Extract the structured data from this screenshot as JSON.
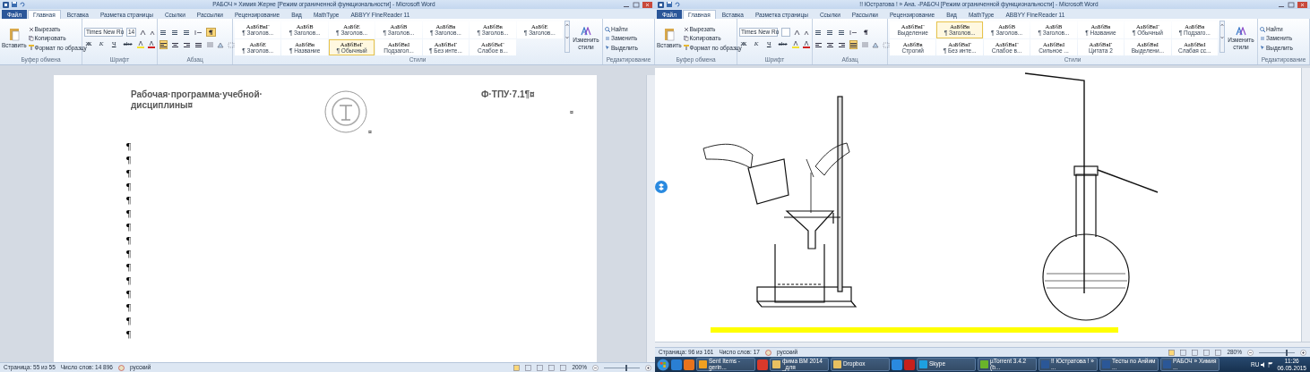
{
  "windows": [
    {
      "title": "РАБОЧ » Химия Жерне [Режим ограниченной функциональности] - Microsoft Word",
      "tabs": [
        {
          "label": "Файл",
          "selected": false
        },
        {
          "label": "Главная",
          "selected": true
        },
        {
          "label": "Вставка",
          "selected": false
        },
        {
          "label": "Разметка страницы",
          "selected": false
        },
        {
          "label": "Ссылки",
          "selected": false
        },
        {
          "label": "Рассылки",
          "selected": false
        },
        {
          "label": "Рецензирование",
          "selected": false
        },
        {
          "label": "Вид",
          "selected": false
        },
        {
          "label": "MathType",
          "selected": false
        },
        {
          "label": "ABBYY FineReader 11",
          "selected": false
        }
      ],
      "clipboard": {
        "paste": "Вставить",
        "commands": [
          "Вырезать",
          "Копировать",
          "Формат по образцу"
        ]
      },
      "font": {
        "name": "Times New Ro",
        "size": "14",
        "buttons": [
          "Ж",
          "К",
          "Ч",
          "abc"
        ]
      },
      "paragraph": {
        "show_marks": true,
        "align_buttons": [
          {
            "selected": true
          },
          {
            "selected": false
          },
          {
            "selected": false
          },
          {
            "selected": false
          }
        ]
      },
      "styles": [
        {
          "sample": "АаБбВвГ",
          "name": "¶ Заголов...",
          "selected": false
        },
        {
          "sample": "АаБбВ",
          "name": "¶ Заголов...",
          "selected": false
        },
        {
          "sample": "АаБбЕ",
          "name": "¶ Заголов...",
          "selected": false
        },
        {
          "sample": "АаБбВ",
          "name": "¶ Заголов...",
          "selected": false
        },
        {
          "sample": "АаБбВв",
          "name": "¶ Заголов...",
          "selected": false
        },
        {
          "sample": "АаБбВв",
          "name": "¶ Заголов...",
          "selected": false
        },
        {
          "sample": "АаБбЕ",
          "name": "¶ Заголов...",
          "selected": false
        },
        {
          "sample": "АаБбЕ",
          "name": "¶ Заголов...",
          "selected": false
        },
        {
          "sample": "АаБбВв",
          "name": "¶ Название",
          "selected": false
        },
        {
          "sample": "АаБбВеГ",
          "name": "¶ Обычный",
          "selected": true
        },
        {
          "sample": "АаБбВвI",
          "name": "Подзагол...",
          "selected": false
        },
        {
          "sample": "АаБбВеГ",
          "name": "¶ Без инте...",
          "selected": false
        },
        {
          "sample": "АаБбВеГ",
          "name": "Слабое в...",
          "selected": false
        }
      ],
      "change_styles": "Изменить стили",
      "editing": [
        "Найти",
        "Заменить",
        "Выделить"
      ],
      "group_labels": [
        "Буфер обмена",
        "Шрифт",
        "Абзац",
        "Стили",
        "Редактирование"
      ],
      "document": {
        "kind": "text_page",
        "header": [
          "Рабочая·программа·учебной· дисциплины¤",
          "¤",
          "Ф·ТПУ·7.1¶¤"
        ],
        "row_end_mark": "¤",
        "paragraphs": [
          "¶",
          "¶",
          "¶",
          "¶",
          "¶",
          "¶",
          "¶",
          "¶",
          "¶",
          "¶",
          "¶",
          "¶",
          "¶",
          "¶",
          "¶"
        ]
      },
      "status_bar": {
        "page": "Страница: 55 из 55",
        "words": "Число слов: 14 896",
        "language": "русский",
        "zoom": {
          "reading": "200%",
          "level": 0.6
        }
      }
    },
    {
      "title": "!! Юстратова ! » Ана. -РАБОЧ [Режим ограниченной функциональности] - Microsoft Word",
      "tabs": [
        {
          "label": "Файл",
          "selected": false
        },
        {
          "label": "Главная",
          "selected": true
        },
        {
          "label": "Вставка",
          "selected": false
        },
        {
          "label": "Разметка страницы",
          "selected": false
        },
        {
          "label": "Ссылки",
          "selected": false
        },
        {
          "label": "Рассылки",
          "selected": false
        },
        {
          "label": "Рецензирование",
          "selected": false
        },
        {
          "label": "Вид",
          "selected": false
        },
        {
          "label": "MathType",
          "selected": false
        },
        {
          "label": "ABBYY FineReader 11",
          "selected": false
        }
      ],
      "clipboard": {
        "paste": "Вставить",
        "commands": [
          "Вырезать",
          "Копировать",
          "Формат по образцу"
        ]
      },
      "font": {
        "name": "Times New Ro",
        "buttons": [
          "Ж",
          "К",
          "Ч",
          "abc"
        ]
      },
      "paragraph": {
        "show_marks": false,
        "align_buttons": [
          {
            "selected": false
          },
          {
            "selected": false
          },
          {
            "selected": false
          },
          {
            "selected": true
          }
        ]
      },
      "styles": [
        {
          "sample": "АаБбВвГ",
          "name": "Выделение",
          "selected": false
        },
        {
          "sample": "АаБбВв",
          "name": "¶ Заголов...",
          "selected": true
        },
        {
          "sample": "АаБбВ",
          "name": "¶ Заголов...",
          "selected": false
        },
        {
          "sample": "АаБбВ",
          "name": "¶ Заголов...",
          "selected": false
        },
        {
          "sample": "АаБбВв",
          "name": "¶ Название",
          "selected": false
        },
        {
          "sample": "АаБбВвГ",
          "name": "¶ Обычный",
          "selected": false
        },
        {
          "sample": "АаБбВв",
          "name": "¶ Подзаго...",
          "selected": false
        },
        {
          "sample": "АаБбВв",
          "name": "Строгий",
          "selected": false
        },
        {
          "sample": "АаБбВвГ",
          "name": "¶ Без инте...",
          "selected": false
        },
        {
          "sample": "АаБбВвГ",
          "name": "Слабое в...",
          "selected": false
        },
        {
          "sample": "АаБбВвI",
          "name": "Сильное ...",
          "selected": false
        },
        {
          "sample": "АаБбВвГ",
          "name": "Цитата 2",
          "selected": false
        },
        {
          "sample": "АаБбВвI",
          "name": "Выделени...",
          "selected": false
        },
        {
          "sample": "АаБбВвI",
          "name": "Слабая сс...",
          "selected": false
        }
      ],
      "change_styles": "Изменить стили",
      "editing": [
        "Найти",
        "Заменить",
        "Выделить"
      ],
      "group_labels": [
        "Буфер обмена",
        "Шрифт",
        "Абзац",
        "Стили",
        "Редактирование"
      ],
      "document": {
        "kind": "figure_page",
        "highlighted_line": true
      },
      "status_bar": {
        "page": "Страница: 96 из 161",
        "words": "Число слов: 17",
        "language": "русский",
        "zoom": {
          "reading": "280%",
          "level": 0.75
        }
      }
    }
  ],
  "taskbar": {
    "items": [
      {
        "kind": "start",
        "color": "#3a8fd8"
      },
      {
        "kind": "pinned",
        "color": "#2a7fd4"
      },
      {
        "kind": "pinned",
        "color": "#e8731c"
      },
      {
        "kind": "task",
        "label": "Sent Items - gerin...",
        "color": "#f0a020"
      },
      {
        "kind": "pinned",
        "color": "#d8392b"
      },
      {
        "kind": "task",
        "label": "фима ВМ 2014 _для",
        "color": "#e8c060"
      },
      {
        "kind": "task",
        "label": "Dropbox",
        "color": "#e8c060"
      },
      {
        "kind": "pinned",
        "color": "#2a8ae0"
      },
      {
        "kind": "pinned",
        "color": "#c8201c"
      },
      {
        "kind": "task",
        "label": "Skype",
        "color": "#1ea0e0"
      },
      {
        "kind": "task",
        "label": "µTorrent 3.4.2 (b...",
        "color": "#6ab42a"
      },
      {
        "kind": "task",
        "label": "!! Юстратова ! » ...",
        "color": "#2b5797"
      },
      {
        "kind": "task",
        "label": "Тесты по Анйим ...",
        "color": "#2b5797"
      },
      {
        "kind": "task",
        "label": "РАБОЧ » Химия ...",
        "color": "#2b5797"
      }
    ],
    "language": "RU",
    "time": "11:26",
    "date": "06.05.2015"
  }
}
